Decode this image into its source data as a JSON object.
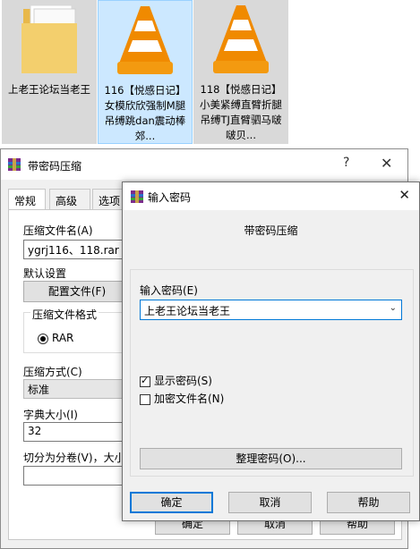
{
  "explorer": {
    "files": [
      {
        "name": "上老王论坛当老王",
        "icon": "folder-icon"
      },
      {
        "name": "116【悦感日记】女模欣欣强制M腿吊缚跳dan震动棒郊...",
        "icon": "vlc-cone-icon"
      },
      {
        "name": "118【悦感日记】小美紧缚直臂折腿吊缚TJ直臂驷马啵啵贝...",
        "icon": "vlc-cone-icon"
      }
    ]
  },
  "archive_dialog": {
    "title": "带密码压缩",
    "tabs": [
      "常规",
      "高级",
      "选项"
    ],
    "archive_name_label": "压缩文件名(A)",
    "archive_name_value": "ygrj116、118.rar",
    "default_settings_label": "默认设置",
    "profiles_button": "配置文件(F)",
    "format_group_label": "压缩文件格式",
    "format_option": "RAR",
    "method_label": "压缩方式(C)",
    "method_value": "标准",
    "dict_label": "字典大小(I)",
    "dict_value": "32",
    "split_label": "切分为分卷(V)，大小",
    "ok_button": "确定",
    "cancel_button": "取消",
    "help_button": "帮助"
  },
  "password_dialog": {
    "title": "输入密码",
    "subtitle": "带密码压缩",
    "password_label": "输入密码(E)",
    "password_value": "上老王论坛当老王",
    "show_password_label": "显示密码(S)",
    "show_password_checked": true,
    "encrypt_names_label": "加密文件名(N)",
    "encrypt_names_checked": false,
    "organize_button": "整理密码(O)...",
    "ok_button": "确定",
    "cancel_button": "取消",
    "help_button": "帮助"
  },
  "colors": {
    "selection_bg": "#cce8ff",
    "focus_border": "#0078d7",
    "vlc_orange": "#f08a00"
  }
}
